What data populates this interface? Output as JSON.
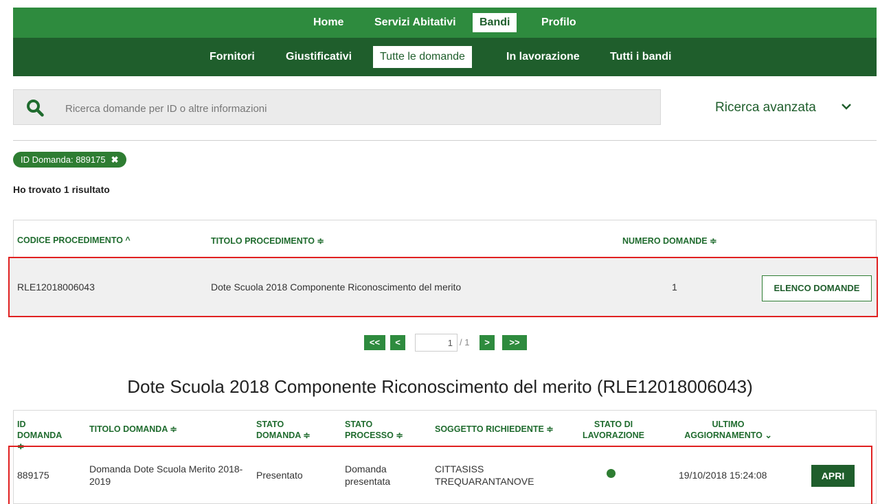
{
  "nav": {
    "top": [
      {
        "label": "Home",
        "active": false
      },
      {
        "label": "Servizi Abitativi",
        "active": false
      },
      {
        "label": "Bandi",
        "active": true
      },
      {
        "label": "Profilo",
        "active": false
      }
    ],
    "sub": [
      {
        "label": "Fornitori",
        "active": false
      },
      {
        "label": "Giustificativi",
        "active": false
      },
      {
        "label": "Tutte le domande",
        "active": true
      },
      {
        "label": "In lavorazione",
        "active": false
      },
      {
        "label": "Tutti i bandi",
        "active": false
      }
    ]
  },
  "search": {
    "placeholder": "Ricerca domande per ID o altre informazioni",
    "value": "",
    "advanced_label": "Ricerca avanzata"
  },
  "filter_chip": {
    "label": "ID Domanda: 889175",
    "remove": "✖"
  },
  "results_text": "Ho trovato 1 risultato",
  "table1": {
    "headers": {
      "codice": "CODICE PROCEDIMENTO ^",
      "titolo": "TITOLO PROCEDIMENTO ≑",
      "numero": "NUMERO DOMANDE ≑"
    },
    "rows": [
      {
        "codice": "RLE12018006043",
        "titolo": "Dote Scuola 2018 Componente Riconoscimento del merito",
        "numero": "1",
        "action": "ELENCO DOMANDE"
      }
    ]
  },
  "pagination": {
    "first": "<<",
    "prev": "<",
    "page": "1",
    "total": "/ 1",
    "next": ">",
    "last": ">>"
  },
  "section_title": "Dote Scuola 2018 Componente Riconoscimento del merito (RLE12018006043)",
  "table2": {
    "headers": {
      "id": "ID DOMANDA ≑",
      "titolo": "TITOLO DOMANDA ≑",
      "stato_domanda": "STATO DOMANDA ≑",
      "stato_processo": "STATO PROCESSO ≑",
      "soggetto": "SOGGETTO RICHIEDENTE ≑",
      "stato_lavorazione": "STATO DI LAVORAZIONE",
      "ultimo": "ULTIMO AGGIORNAMENTO ⌄"
    },
    "rows": [
      {
        "id": "889175",
        "titolo": "Domanda Dote Scuola Merito 2018-2019",
        "stato_domanda": "Presentato",
        "stato_processo": "Domanda presentata",
        "soggetto": "CITTASISS TREQUARANTANOVE",
        "ultimo": "19/10/2018 15:24:08",
        "action": "APRI"
      }
    ]
  },
  "colors": {
    "primary": "#2e8b3e",
    "dark": "#1f5e2c",
    "highlight": "#e02020"
  },
  "icons": {
    "search": "search-icon",
    "dropdown": "chevron-down-icon",
    "status": "status-dot-icon"
  }
}
